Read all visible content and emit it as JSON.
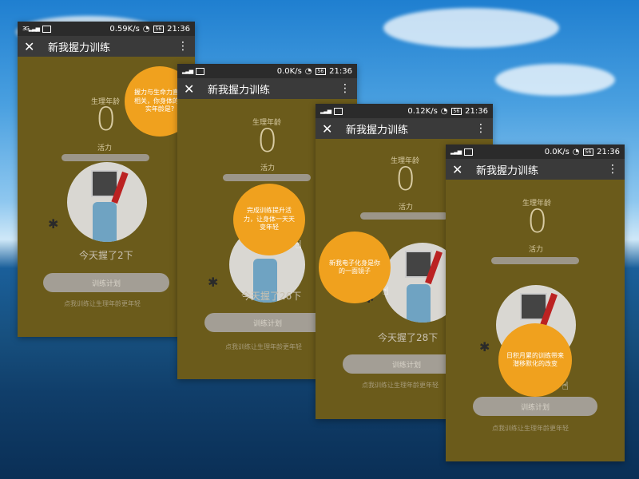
{
  "screens": [
    {
      "status": {
        "speed": "0.59K/s",
        "time": "21:36",
        "battery": "56"
      },
      "appbar": {
        "close": "✕",
        "title": "新我握力训练",
        "menu": "⋮"
      },
      "labels": {
        "age": "生理年龄",
        "age_value": "0",
        "vitality": "活力"
      },
      "count_text": "今天握了2下",
      "plan_button": "训练计划",
      "hint": "点我训练让生理年龄更年轻",
      "bubble": "握力与生命力直接相关，你身体的真实年龄是?"
    },
    {
      "status": {
        "speed": "0.0K/s",
        "time": "21:36",
        "battery": "56"
      },
      "appbar": {
        "close": "✕",
        "title": "新我握力训练",
        "menu": "⋮"
      },
      "labels": {
        "age": "生理年龄",
        "age_value": "0",
        "vitality": "活力"
      },
      "count_text": "今天握了26下",
      "plan_button": "训练计划",
      "hint": "点我训练让生理年龄更年轻",
      "bubble": "完成训练提升活力，让身体一天天变年轻"
    },
    {
      "status": {
        "speed": "0.12K/s",
        "time": "21:36",
        "battery": "56"
      },
      "appbar": {
        "close": "✕",
        "title": "新我握力训练",
        "menu": "⋮"
      },
      "labels": {
        "age": "生理年龄",
        "age_value": "0",
        "vitality": "活力"
      },
      "count_text": "今天握了28下",
      "plan_button": "训练计划",
      "hint": "点我训练让生理年龄更年轻",
      "bubble": "新我电子化身是你的一面镜子"
    },
    {
      "status": {
        "speed": "0.0K/s",
        "time": "21:36",
        "battery": "56"
      },
      "appbar": {
        "close": "✕",
        "title": "新我握力训练",
        "menu": "⋮"
      },
      "labels": {
        "age": "生理年龄",
        "age_value": "0",
        "vitality": "活力"
      },
      "count_text": "",
      "plan_button": "训练计划",
      "hint": "点我训练让生理年龄更年轻",
      "bubble": "日积月累的训练带来潜移默化的改变"
    }
  ],
  "colors": {
    "screen_bg": "#6b5b1b",
    "bubble": "#f0a11e",
    "appbar": "#3a3a3a"
  }
}
